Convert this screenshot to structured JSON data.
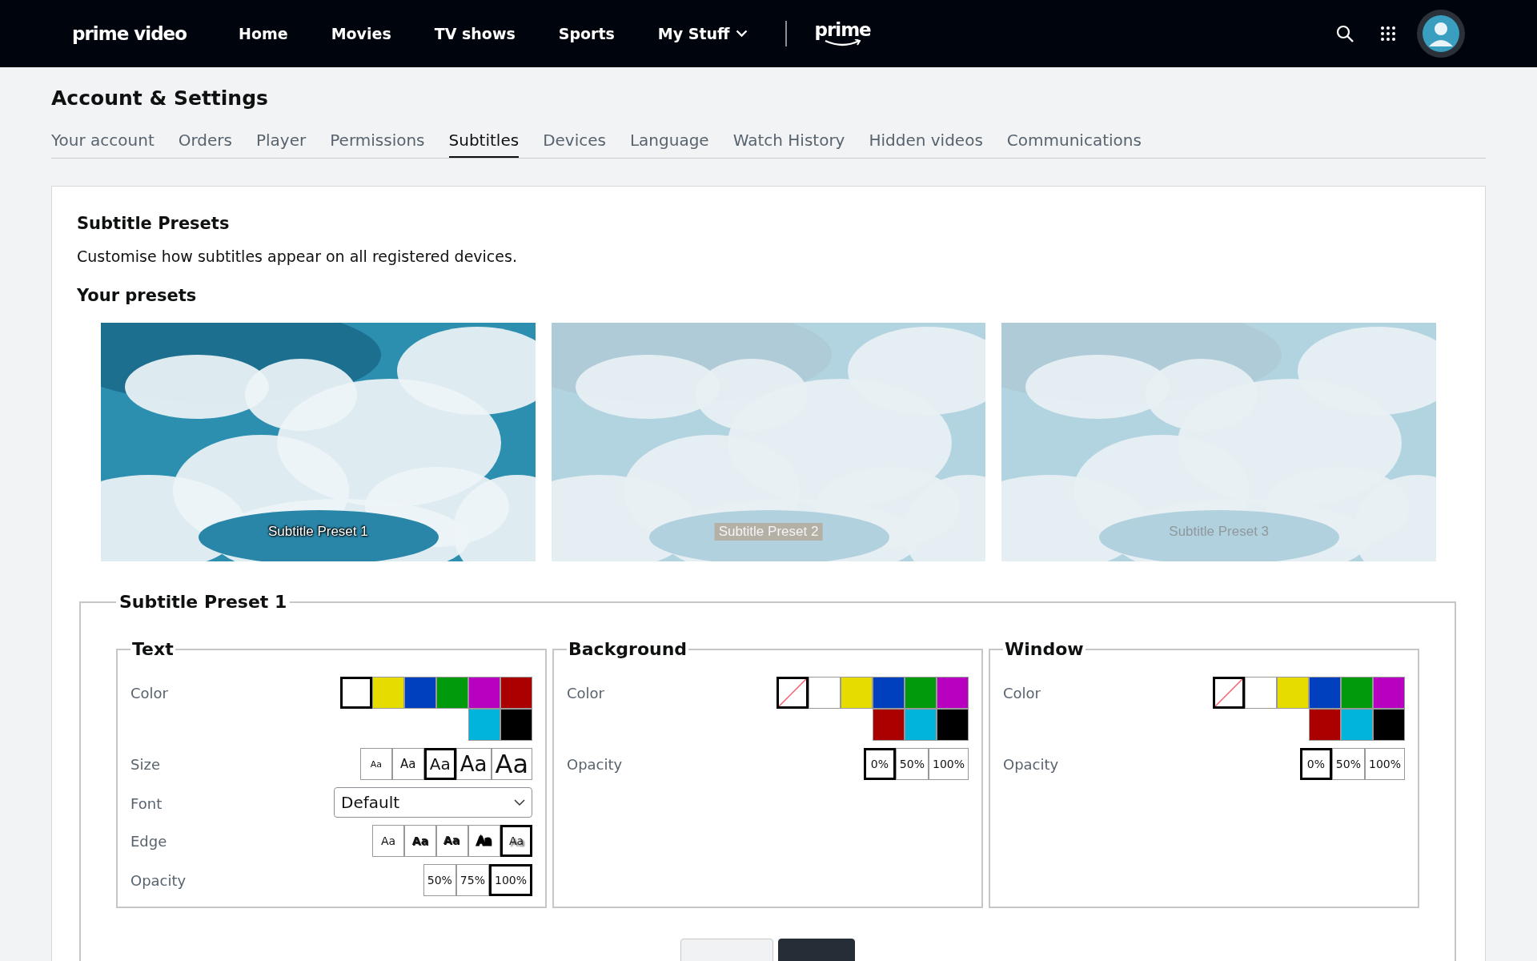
{
  "header": {
    "logo": "prime video",
    "nav": [
      {
        "label": "Home",
        "selected": false
      },
      {
        "label": "Movies",
        "selected": false
      },
      {
        "label": "TV shows",
        "selected": false
      },
      {
        "label": "Sports",
        "selected": false
      },
      {
        "label": "My Stuff",
        "selected": false,
        "dropdown": true
      }
    ],
    "brand": "prime"
  },
  "page_title": "Account & Settings",
  "tabs": [
    {
      "label": "Your account",
      "selected": false
    },
    {
      "label": "Orders",
      "selected": false
    },
    {
      "label": "Player",
      "selected": false
    },
    {
      "label": "Permissions",
      "selected": false
    },
    {
      "label": "Subtitles",
      "selected": true
    },
    {
      "label": "Devices",
      "selected": false
    },
    {
      "label": "Language",
      "selected": false
    },
    {
      "label": "Watch History",
      "selected": false
    },
    {
      "label": "Hidden videos",
      "selected": false
    },
    {
      "label": "Communications",
      "selected": false
    }
  ],
  "section_title": "Subtitle Presets",
  "description": "Customise how subtitles appear on all registered devices.",
  "presets_title": "Your presets",
  "presets": [
    {
      "label": "Subtitle Preset 1",
      "selected": true,
      "kind": "shadow"
    },
    {
      "label": "Subtitle Preset 2",
      "selected": false,
      "kind": "boxed"
    },
    {
      "label": "Subtitle Preset 3",
      "selected": false,
      "kind": "faint"
    }
  ],
  "editor": {
    "title": "Subtitle Preset 1",
    "groups": [
      {
        "title": "Text",
        "rows": [
          {
            "kind": "colors",
            "label": "Color",
            "swatches": [
              {
                "color": "#ffffff",
                "selected": true
              },
              {
                "color": "#e6dc00",
                "selected": false
              },
              {
                "color": "#0040bf",
                "selected": false
              },
              {
                "color": "#009a0c",
                "selected": false
              },
              {
                "color": "#b800c0",
                "selected": false
              },
              {
                "color": "#ab0000",
                "selected": false
              },
              {
                "color": "#00b4db",
                "selected": false
              },
              {
                "color": "#000000",
                "selected": false
              }
            ]
          },
          {
            "kind": "sizes",
            "label": "Size",
            "options": [
              {
                "text": "Aa",
                "selected": false
              },
              {
                "text": "Aa",
                "selected": false
              },
              {
                "text": "Aa",
                "selected": true
              },
              {
                "text": "Aa",
                "selected": false
              },
              {
                "text": "Aa",
                "selected": false
              }
            ]
          },
          {
            "kind": "dropdown",
            "label": "Font",
            "value": "Default"
          },
          {
            "kind": "edges",
            "label": "Edge",
            "options": [
              {
                "text": "Aa",
                "kind": "none",
                "selected": false
              },
              {
                "text": "Aa",
                "kind": "raised",
                "selected": false
              },
              {
                "text": "Aa",
                "kind": "depressed",
                "selected": false
              },
              {
                "text": "Aa",
                "kind": "outline",
                "selected": false
              },
              {
                "text": "Aa",
                "kind": "shadow",
                "selected": true
              }
            ]
          },
          {
            "kind": "options",
            "label": "Opacity",
            "options": [
              {
                "text": "50%",
                "selected": false
              },
              {
                "text": "75%",
                "selected": false
              },
              {
                "text": "100%",
                "selected": true
              }
            ]
          }
        ]
      },
      {
        "title": "Background",
        "rows": [
          {
            "kind": "colors",
            "label": "Color",
            "swatches": [
              {
                "kind": "none",
                "selected": true
              },
              {
                "color": "#ffffff",
                "selected": false
              },
              {
                "color": "#e6dc00",
                "selected": false
              },
              {
                "color": "#0040bf",
                "selected": false
              },
              {
                "color": "#009a0c",
                "selected": false
              },
              {
                "color": "#b800c0",
                "selected": false
              },
              {
                "color": "#ab0000",
                "selected": false
              },
              {
                "color": "#00b4db",
                "selected": false
              },
              {
                "color": "#000000",
                "selected": false
              }
            ]
          },
          {
            "kind": "options",
            "label": "Opacity",
            "options": [
              {
                "text": "0%",
                "selected": true
              },
              {
                "text": "50%",
                "selected": false
              },
              {
                "text": "100%",
                "selected": false
              }
            ]
          }
        ]
      },
      {
        "title": "Window",
        "rows": [
          {
            "kind": "colors",
            "label": "Color",
            "swatches": [
              {
                "kind": "none",
                "selected": true
              },
              {
                "color": "#ffffff",
                "selected": false
              },
              {
                "color": "#e6dc00",
                "selected": false
              },
              {
                "color": "#0040bf",
                "selected": false
              },
              {
                "color": "#009a0c",
                "selected": false
              },
              {
                "color": "#b800c0",
                "selected": false
              },
              {
                "color": "#ab0000",
                "selected": false
              },
              {
                "color": "#00b4db",
                "selected": false
              },
              {
                "color": "#000000",
                "selected": false
              }
            ]
          },
          {
            "kind": "options",
            "label": "Opacity",
            "options": [
              {
                "text": "0%",
                "selected": true
              },
              {
                "text": "50%",
                "selected": false
              },
              {
                "text": "100%",
                "selected": false
              }
            ]
          }
        ]
      }
    ],
    "buttons": [
      {
        "kind": "secondary"
      },
      {
        "kind": "primary"
      }
    ]
  }
}
